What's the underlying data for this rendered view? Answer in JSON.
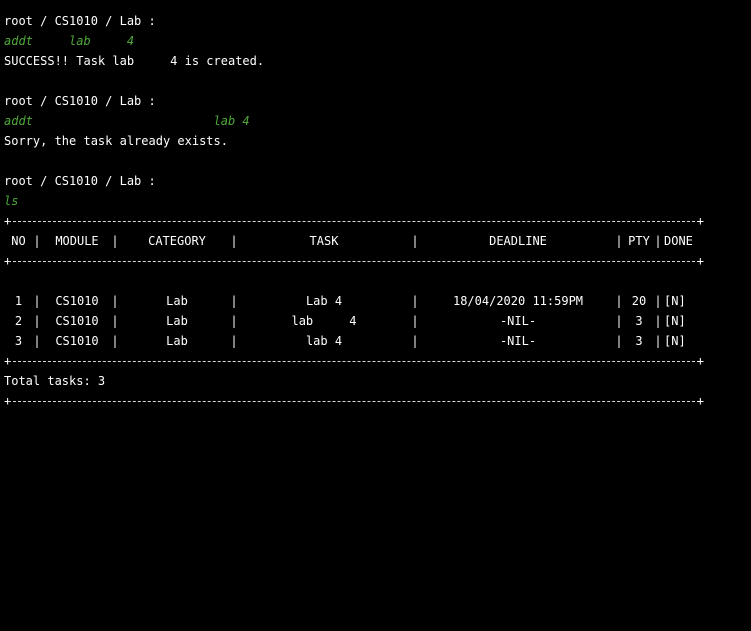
{
  "session": {
    "blocks": [
      {
        "prompt": "root / CS1010 / Lab :",
        "command": "addt     lab     4",
        "output": "SUCCESS!! Task lab     4 is created."
      },
      {
        "prompt": "root / CS1010 / Lab :",
        "command": "addt                         lab 4",
        "output": "Sorry, the task already exists."
      },
      {
        "prompt": "root / CS1010 / Lab :",
        "command": "ls"
      }
    ]
  },
  "table": {
    "corner": "+",
    "separator": "|",
    "headers": {
      "no": "NO",
      "module": "MODULE",
      "category": "CATEGORY",
      "task": "TASK",
      "deadline": "DEADLINE",
      "pty": "PTY",
      "done": "DONE"
    },
    "rows": [
      {
        "no": "1",
        "module": "CS1010",
        "category": "Lab",
        "task": "Lab 4",
        "deadline": "18/04/2020 11:59PM",
        "pty": "20",
        "done": "[N]"
      },
      {
        "no": "2",
        "module": "CS1010",
        "category": "Lab",
        "task": "lab     4",
        "deadline": "-NIL-",
        "pty": "3",
        "done": "[N]"
      },
      {
        "no": "3",
        "module": "CS1010",
        "category": "Lab",
        "task": "lab 4",
        "deadline": "-NIL-",
        "pty": "3",
        "done": "[N]"
      }
    ],
    "total": "Total tasks: 3"
  },
  "colors": {
    "background": "#000000",
    "text": "#ffffff",
    "command": "#4fa83a"
  }
}
